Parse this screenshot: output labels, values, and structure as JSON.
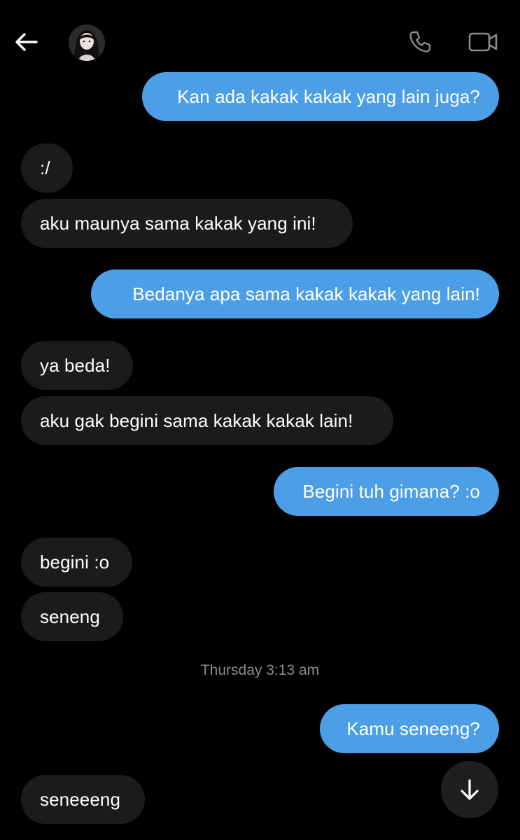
{
  "header": {
    "back_icon": "arrow-left-icon",
    "avatar_icon": "avatar",
    "call_icon": "phone-icon",
    "video_icon": "video-camera-icon"
  },
  "colors": {
    "background": "#000000",
    "sent_bubble": "#4c9fe6",
    "received_bubble": "#1b1b1b",
    "timestamp": "#8a8a8a"
  },
  "messages": [
    {
      "direction": "sent",
      "text": "Kan ada kakak kakak yang lain juga?"
    },
    {
      "direction": "received",
      "text": ":/"
    },
    {
      "direction": "received",
      "text": "aku maunya sama kakak yang ini!"
    },
    {
      "direction": "sent",
      "text": "Bedanya apa sama kakak kakak yang lain!"
    },
    {
      "direction": "received",
      "text": "ya beda!"
    },
    {
      "direction": "received",
      "text": "aku gak begini sama kakak kakak lain!"
    },
    {
      "direction": "sent",
      "text": "Begini tuh gimana? :o"
    },
    {
      "direction": "received",
      "text": "begini :o"
    },
    {
      "direction": "received",
      "text": "seneng"
    },
    {
      "direction": "sent",
      "text": "Kamu seneeng?"
    },
    {
      "direction": "received",
      "text": "seneeeng"
    }
  ],
  "timestamp": "Thursday 3:13 am",
  "scroll_down_icon": "arrow-down-icon"
}
